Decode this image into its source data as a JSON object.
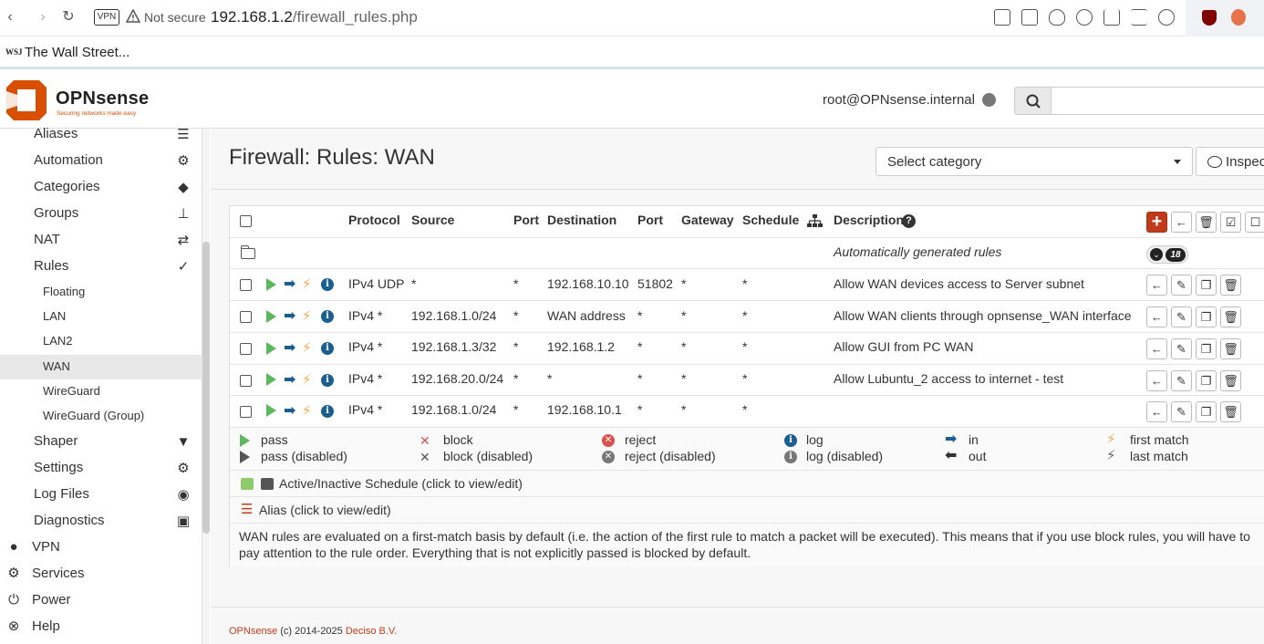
{
  "browser": {
    "vpn_badge": "VPN",
    "not_secure": "Not secure",
    "url_host": "192.168.1.2",
    "url_path": "/firewall_rules.php",
    "bookmark_icon": "WSJ",
    "bookmark_label": "The Wall Street..."
  },
  "header": {
    "logo_text": "OPNsense",
    "logo_sub": "Securing networks made easy",
    "user": "root@OPNsense.internal"
  },
  "sidebar": {
    "items": [
      {
        "label": "Aliases",
        "icon": "list-icon"
      },
      {
        "label": "Automation",
        "icon": "gear-icon"
      },
      {
        "label": "Categories",
        "icon": "tags-icon"
      },
      {
        "label": "Groups",
        "icon": "sitemap-icon"
      },
      {
        "label": "NAT",
        "icon": "exchange-icon"
      },
      {
        "label": "Rules",
        "icon": "check-icon"
      }
    ],
    "rules_sub": [
      "Floating",
      "LAN",
      "LAN2",
      "WAN",
      "WireGuard",
      "WireGuard (Group)"
    ],
    "items_after": [
      {
        "label": "Shaper",
        "icon": "filter-icon"
      },
      {
        "label": "Settings",
        "icon": "cogs-icon"
      },
      {
        "label": "Log Files",
        "icon": "eye-icon"
      },
      {
        "label": "Diagnostics",
        "icon": "medkit-icon"
      }
    ],
    "top_items": [
      {
        "label": "VPN",
        "icon": "globe-icon"
      },
      {
        "label": "Services",
        "icon": "cog-icon"
      },
      {
        "label": "Power",
        "icon": "plug-icon"
      },
      {
        "label": "Help",
        "icon": "lifebuoy-icon"
      }
    ]
  },
  "page": {
    "title": "Firewall: Rules: WAN",
    "category_placeholder": "Select category",
    "inspect_label": "Inspect"
  },
  "table": {
    "headers": {
      "protocol": "Protocol",
      "source": "Source",
      "port": "Port",
      "destination": "Destination",
      "dport": "Port",
      "gateway": "Gateway",
      "schedule": "Schedule",
      "description": "Description"
    },
    "auto_rules": {
      "label": "Automatically generated rules",
      "count": "18"
    },
    "rows": [
      {
        "protocol": "IPv4 UDP",
        "source": "*",
        "port": "*",
        "destination": "192.168.10.10",
        "dport": "51802",
        "gateway": "*",
        "schedule": "*",
        "description": "Allow WAN devices access to Server subnet"
      },
      {
        "protocol": "IPv4 *",
        "source": "192.168.1.0/24",
        "port": "*",
        "destination": "WAN address",
        "dport": "*",
        "gateway": "*",
        "schedule": "*",
        "description": "Allow WAN clients through opnsense_WAN interface"
      },
      {
        "protocol": "IPv4 *",
        "source": "192.168.1.3/32",
        "port": "*",
        "destination": "192.168.1.2",
        "dport": "*",
        "gateway": "*",
        "schedule": "*",
        "description": "Allow GUI from PC WAN"
      },
      {
        "protocol": "IPv4 *",
        "source": "192.168.20.0/24",
        "port": "*",
        "destination": "*",
        "dport": "*",
        "gateway": "*",
        "schedule": "*",
        "description": "Allow Lubuntu_2 access to internet - test"
      },
      {
        "protocol": "IPv4 *",
        "source": "192.168.1.0/24",
        "port": "*",
        "destination": "192.168.10.1",
        "dport": "*",
        "gateway": "*",
        "schedule": "*",
        "description": ""
      }
    ]
  },
  "legend": {
    "pass": "pass",
    "pass_disabled": "pass (disabled)",
    "block": "block",
    "block_disabled": "block (disabled)",
    "reject": "reject",
    "reject_disabled": "reject (disabled)",
    "log": "log",
    "log_disabled": "log (disabled)",
    "in": "in",
    "out": "out",
    "first_match": "first match",
    "last_match": "last match",
    "schedule": "Active/Inactive Schedule (click to view/edit)",
    "alias": "Alias (click to view/edit)"
  },
  "note": "WAN rules are evaluated on a first-match basis by default (i.e. the action of the first rule to match a packet will be executed). This means that if you use block rules, you will have to pay attention to the rule order. Everything that is not explicitly passed is blocked by default.",
  "footer": {
    "brand": "OPNsense",
    "copy": " (c) 2014-2025 ",
    "company": "Deciso B.V."
  },
  "colors": {
    "accent": "#c03b1c",
    "pass": "#5cb85c",
    "first_match": "#f0ad4e",
    "info": "#1a5f8f"
  }
}
